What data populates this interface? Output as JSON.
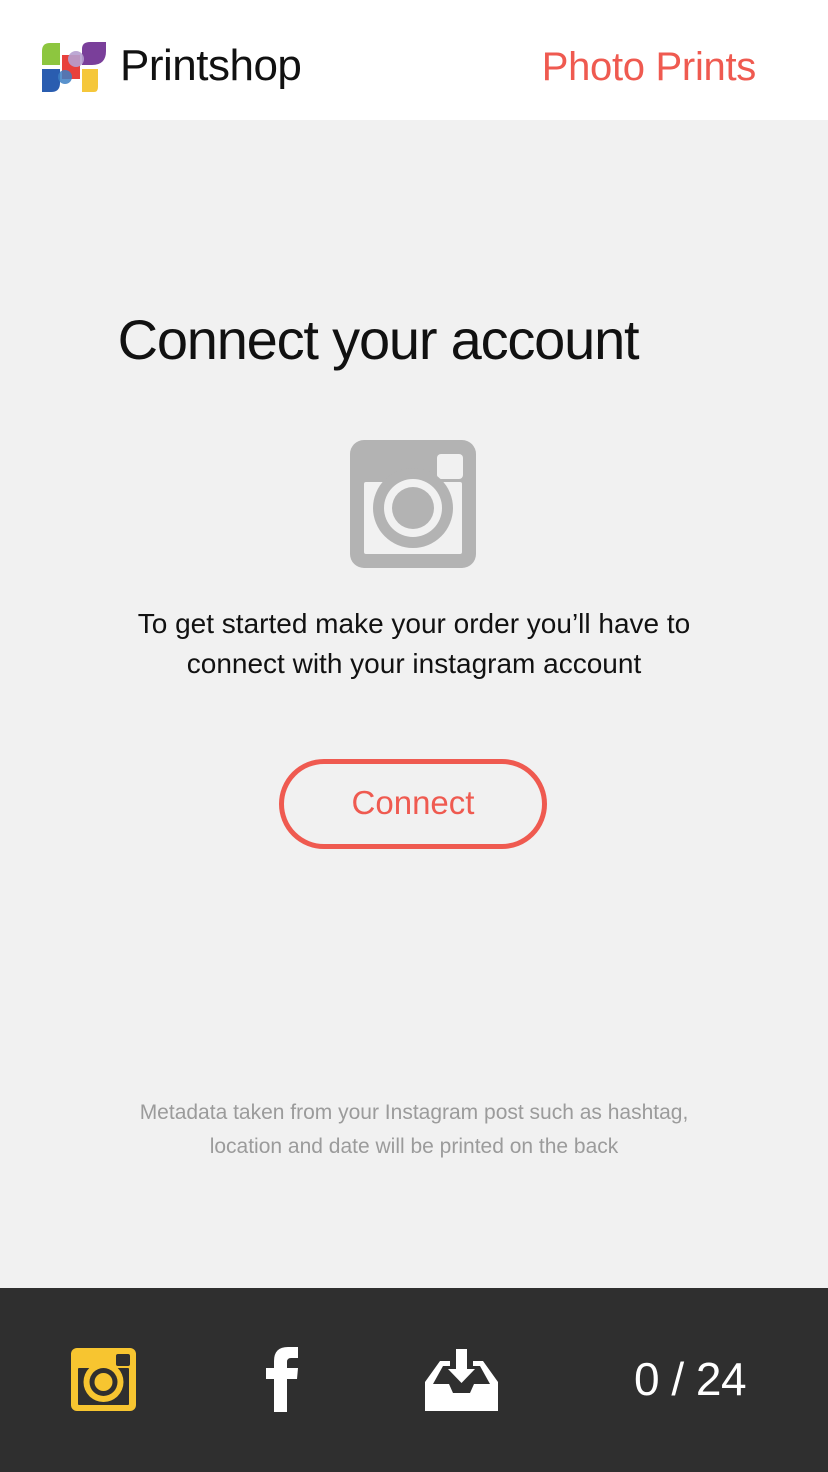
{
  "header": {
    "app_name": "Printshop",
    "logo_icon": "printshop-logo-icon",
    "nav_link": "Photo Prints"
  },
  "main": {
    "title": "Connect your account",
    "icon": "instagram-camera-icon",
    "description": "To get started make your order you’ll have to connect with your instagram account",
    "connect_button": "Connect",
    "footnote": "Metadata taken from your Instagram post such as hashtag, location and date will be printed on the back"
  },
  "tabbar": {
    "tabs": [
      {
        "icon": "instagram-icon",
        "active": true
      },
      {
        "icon": "facebook-icon",
        "active": false
      },
      {
        "icon": "download-tray-icon",
        "active": false
      }
    ],
    "counter": "0 / 24"
  },
  "colors": {
    "accent": "#ef5a50",
    "active_tab": "#f7c530",
    "tabbar_background": "#2f2f2f",
    "page_background": "#f1f1f1",
    "icon_gray": "#b3b3b3"
  }
}
